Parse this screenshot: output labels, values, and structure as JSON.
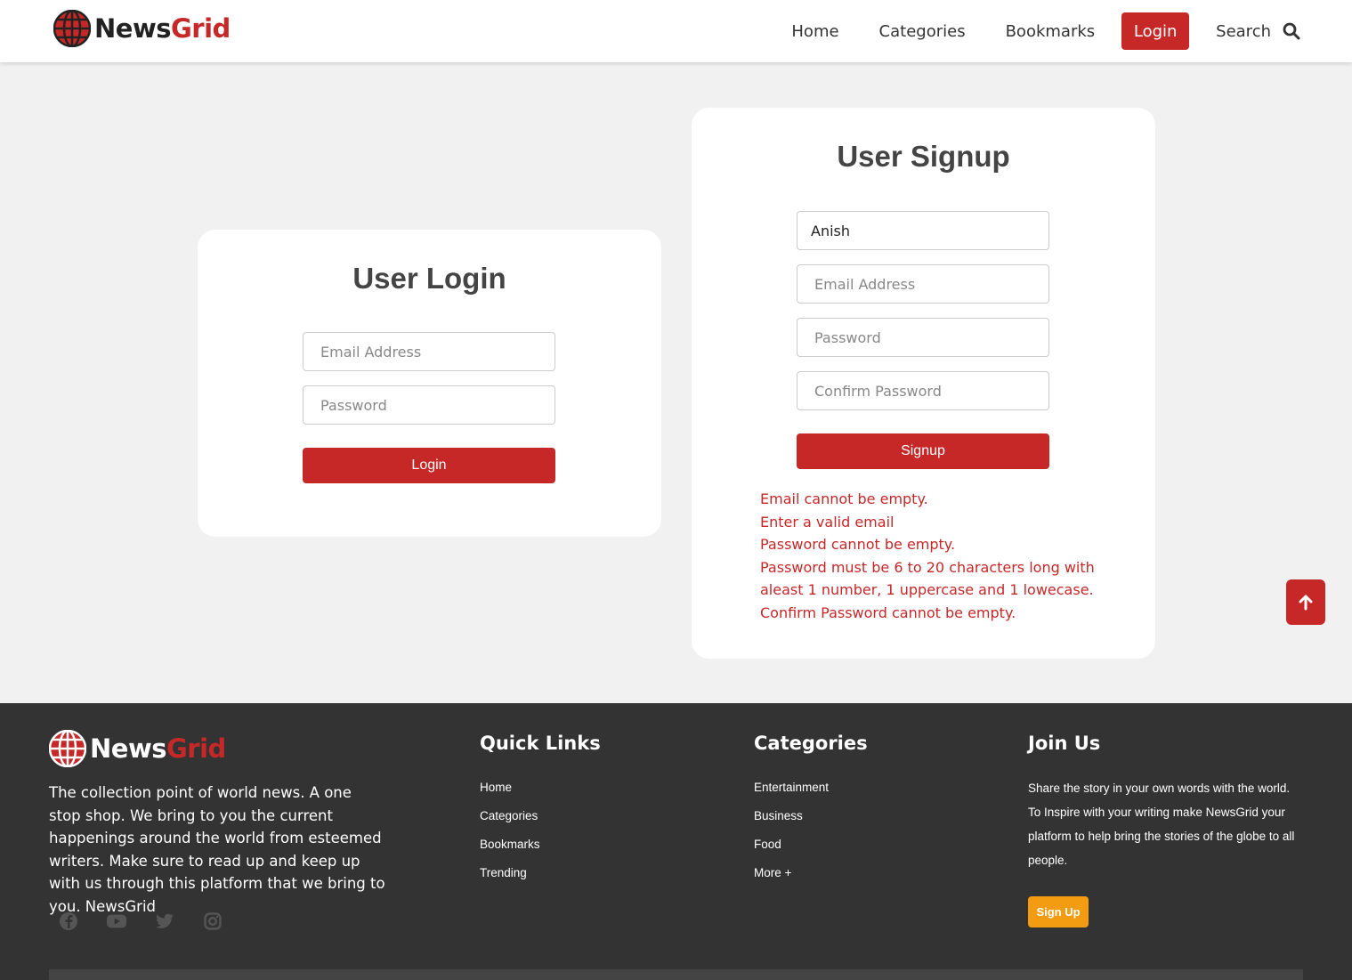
{
  "brand": {
    "part1": "News",
    "part2": "Grid"
  },
  "nav": {
    "links": [
      "Home",
      "Categories",
      "Bookmarks"
    ],
    "login": "Login",
    "search": "Search"
  },
  "login_form": {
    "title": "User Login",
    "email_placeholder": "Email Address",
    "password_placeholder": "Password",
    "button": "Login"
  },
  "signup_form": {
    "title": "User Signup",
    "name_value": "Anish",
    "email_placeholder": "Email Address",
    "password_placeholder": "Password",
    "confirm_placeholder": "Confirm Password",
    "button": "Signup",
    "errors": [
      "Email cannot be empty.",
      "Enter a valid email",
      "Password cannot be empty.",
      "Password must be 6 to 20 characters long with aleast 1 number, 1 uppercase and 1 lowecase.",
      "Confirm Password cannot be empty."
    ]
  },
  "footer": {
    "about": "The collection point of world news. A one stop shop. We bring to you the current happenings around the world from esteemed writers. Make sure to read up and keep up with us through this platform that we bring to you. NewsGrid",
    "socials": [
      "facebook-icon",
      "youtube-icon",
      "twitter-icon",
      "instagram-icon"
    ],
    "quick_links": {
      "title": "Quick Links",
      "items": [
        "Home",
        "Categories",
        "Bookmarks",
        "Trending"
      ]
    },
    "categories": {
      "title": "Categories",
      "items": [
        "Entertainment",
        "Business",
        "Food",
        "More +"
      ]
    },
    "join": {
      "title": "Join Us",
      "text": "Share the story in your own words with the world. To Inspire with your writing make NewsGrid your platform to help bring the stories of the globe to all people.",
      "button": "Sign Up"
    }
  },
  "colors": {
    "accent": "#c62828",
    "footer_bg": "#333333",
    "join_button": "#f39c12"
  }
}
